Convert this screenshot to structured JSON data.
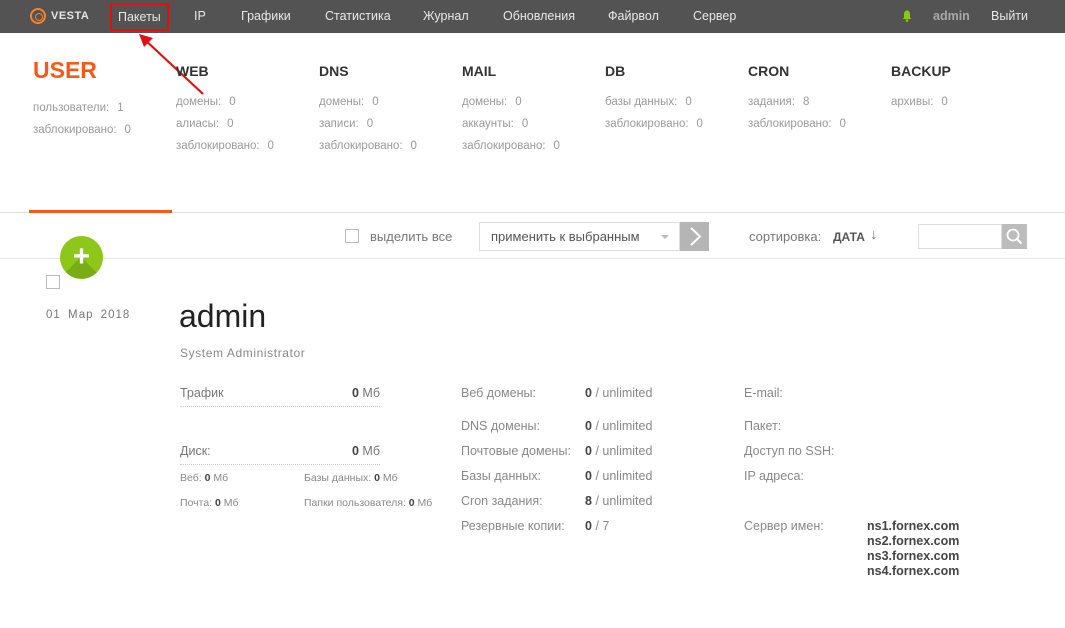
{
  "app": {
    "logo_text": "VESTA"
  },
  "nav": {
    "items": [
      "Пакеты",
      "IP",
      "Графики",
      "Статистика",
      "Журнал",
      "Обновления",
      "Файрвол",
      "Сервер"
    ],
    "user": "admin",
    "logout": "Выйти"
  },
  "colors": {
    "accent": "#f55a1a",
    "add_button": "#8cc71a",
    "topbar": "#535353",
    "highlight": "#e01010"
  },
  "stats": {
    "user": {
      "title": "USER",
      "rows": [
        {
          "label": "пользователи:",
          "value": "1"
        },
        {
          "label": "заблокировано:",
          "value": "0"
        }
      ]
    },
    "web": {
      "title": "WEB",
      "rows": [
        {
          "label": "домены:",
          "value": "0"
        },
        {
          "label": "алиасы:",
          "value": "0"
        },
        {
          "label": "заблокировано:",
          "value": "0"
        }
      ]
    },
    "dns": {
      "title": "DNS",
      "rows": [
        {
          "label": "домены:",
          "value": "0"
        },
        {
          "label": "записи:",
          "value": "0"
        },
        {
          "label": "заблокировано:",
          "value": "0"
        }
      ]
    },
    "mail": {
      "title": "MAIL",
      "rows": [
        {
          "label": "домены:",
          "value": "0"
        },
        {
          "label": "аккаунты:",
          "value": "0"
        },
        {
          "label": "заблокировано:",
          "value": "0"
        }
      ]
    },
    "db": {
      "title": "DB",
      "rows": [
        {
          "label": "базы данных:",
          "value": "0"
        },
        {
          "label": "заблокировано:",
          "value": "0"
        }
      ]
    },
    "cron": {
      "title": "CRON",
      "rows": [
        {
          "label": "задания:",
          "value": "8"
        },
        {
          "label": "заблокировано:",
          "value": "0"
        }
      ]
    },
    "backup": {
      "title": "BACKUP",
      "rows": [
        {
          "label": "архивы:",
          "value": "0"
        }
      ]
    }
  },
  "toolbar": {
    "select_all": "выделить все",
    "apply_placeholder": "применить к выбранным",
    "sort_label": "сортировка:",
    "sort_value": "ДАТА",
    "sort_arrow": "↓",
    "add_label": "+"
  },
  "record": {
    "date": "01 Мар 2018",
    "username": "admin",
    "full_name": "System Administrator",
    "traffic": {
      "label": "Трафик",
      "value": "0",
      "unit": "Мб"
    },
    "disk": {
      "label": "Диск:",
      "value": "0",
      "unit": "Мб"
    },
    "disk_breakdown": {
      "web": {
        "label": "Веб:",
        "value": "0",
        "unit": "Мб"
      },
      "db": {
        "label": "Базы данных:",
        "value": "0",
        "unit": "Мб"
      },
      "mail": {
        "label": "Почта:",
        "value": "0",
        "unit": "Мб"
      },
      "dirs": {
        "label": "Папки пользователя:",
        "value": "0",
        "unit": "Мб"
      }
    },
    "limits": [
      {
        "label": "Веб домены:",
        "used": "0",
        "limit": "/ unlimited"
      },
      {
        "label": "DNS домены:",
        "used": "0",
        "limit": "/ unlimited"
      },
      {
        "label": "Почтовые домены:",
        "used": "0",
        "limit": "/ unlimited"
      },
      {
        "label": "Базы данных:",
        "used": "0",
        "limit": "/ unlimited"
      },
      {
        "label": "Cron задания:",
        "used": "8",
        "limit": "/ unlimited"
      },
      {
        "label": "Резервные копии:",
        "used": "0",
        "limit": "/ 7"
      }
    ],
    "info": {
      "email_label": "E-mail:",
      "package_label": "Пакет:",
      "ssh_label": "Доступ по SSH:",
      "ip_label": "IP адреса:",
      "ns_label": "Сервер имен:",
      "nameservers": [
        "ns1.fornex.com",
        "ns2.fornex.com",
        "ns3.fornex.com",
        "ns4.fornex.com"
      ]
    }
  }
}
